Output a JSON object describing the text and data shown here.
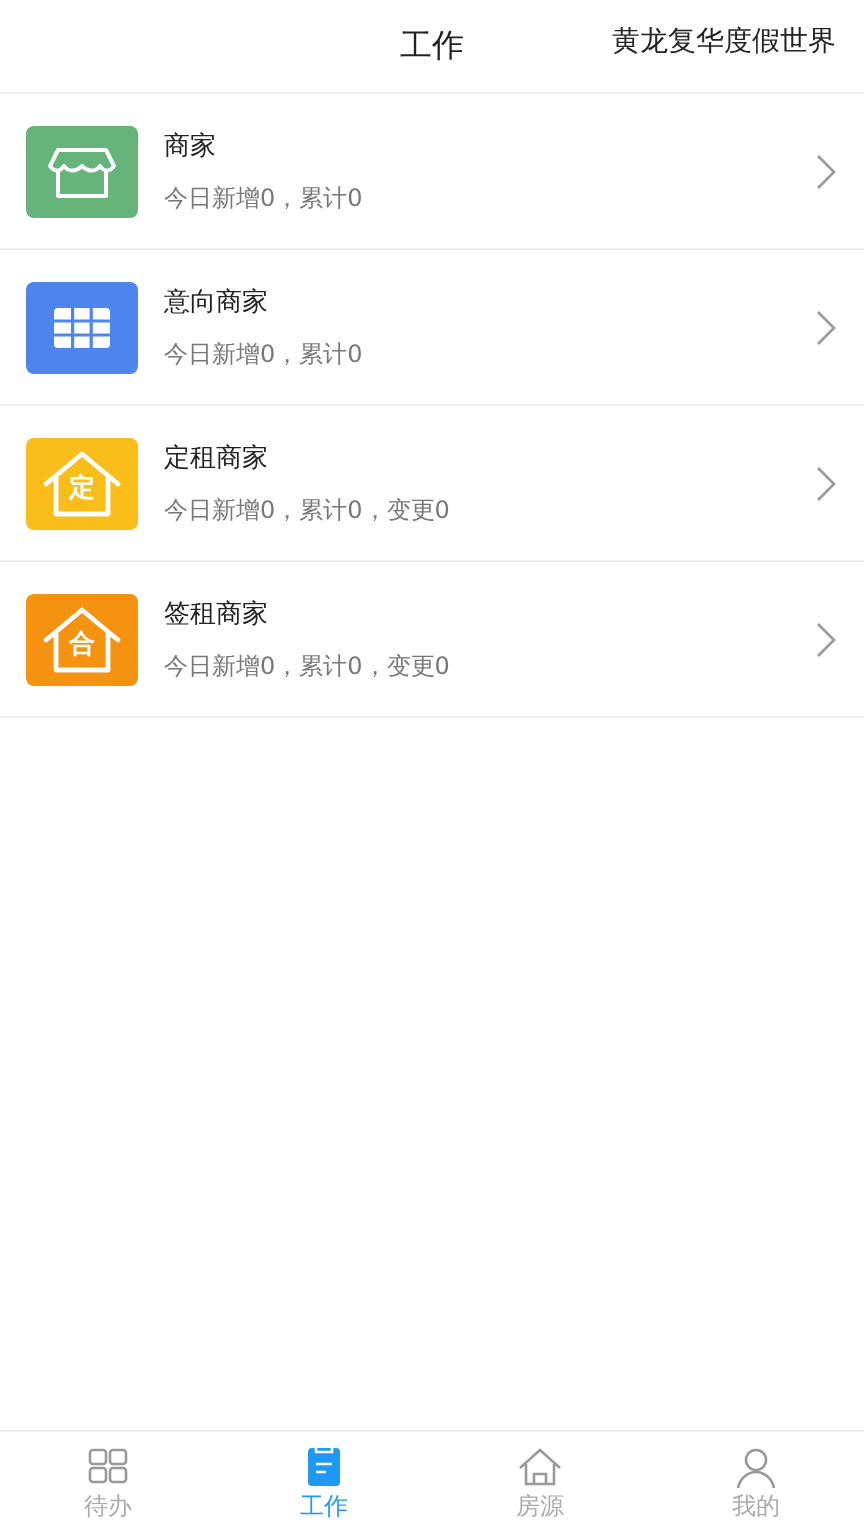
{
  "header": {
    "title": "工作",
    "location": "黄龙复华度假世界"
  },
  "items": [
    {
      "kind": "store",
      "color": "#66b47a",
      "title": "商家",
      "summary": "今日新增0，累计0"
    },
    {
      "kind": "grid",
      "color": "#4d85ec",
      "title": "意向商家",
      "summary": "今日新增0，累计0"
    },
    {
      "kind": "house",
      "color": "#fbbd1a",
      "icon_text": "定",
      "title": "定租商家",
      "summary": "今日新增0，累计0，变更0"
    },
    {
      "kind": "house",
      "color": "#f5920f",
      "icon_text": "合",
      "title": "签租商家",
      "summary": "今日新增0，累计0，变更0"
    }
  ],
  "tabs": [
    {
      "kind": "grid",
      "label": "待办",
      "selected": false
    },
    {
      "kind": "clipboard",
      "label": "工作",
      "selected": true
    },
    {
      "kind": "house",
      "label": "房源",
      "selected": false
    },
    {
      "kind": "person",
      "label": "我的",
      "selected": false
    }
  ]
}
